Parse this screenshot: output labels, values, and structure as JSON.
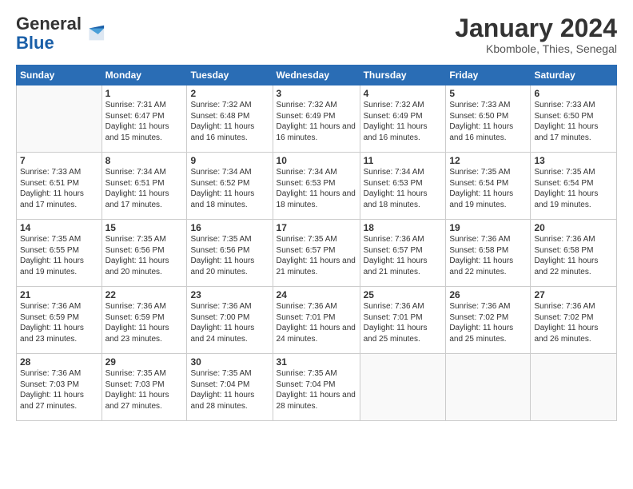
{
  "logo": {
    "general": "General",
    "blue": "Blue"
  },
  "title": "January 2024",
  "subtitle": "Kbombole, Thies, Senegal",
  "days_of_week": [
    "Sunday",
    "Monday",
    "Tuesday",
    "Wednesday",
    "Thursday",
    "Friday",
    "Saturday"
  ],
  "weeks": [
    [
      {
        "day": "",
        "sunrise": "",
        "sunset": "",
        "daylight": ""
      },
      {
        "day": "1",
        "sunrise": "Sunrise: 7:31 AM",
        "sunset": "Sunset: 6:47 PM",
        "daylight": "Daylight: 11 hours and 15 minutes."
      },
      {
        "day": "2",
        "sunrise": "Sunrise: 7:32 AM",
        "sunset": "Sunset: 6:48 PM",
        "daylight": "Daylight: 11 hours and 16 minutes."
      },
      {
        "day": "3",
        "sunrise": "Sunrise: 7:32 AM",
        "sunset": "Sunset: 6:49 PM",
        "daylight": "Daylight: 11 hours and 16 minutes."
      },
      {
        "day": "4",
        "sunrise": "Sunrise: 7:32 AM",
        "sunset": "Sunset: 6:49 PM",
        "daylight": "Daylight: 11 hours and 16 minutes."
      },
      {
        "day": "5",
        "sunrise": "Sunrise: 7:33 AM",
        "sunset": "Sunset: 6:50 PM",
        "daylight": "Daylight: 11 hours and 16 minutes."
      },
      {
        "day": "6",
        "sunrise": "Sunrise: 7:33 AM",
        "sunset": "Sunset: 6:50 PM",
        "daylight": "Daylight: 11 hours and 17 minutes."
      }
    ],
    [
      {
        "day": "7",
        "sunrise": "Sunrise: 7:33 AM",
        "sunset": "Sunset: 6:51 PM",
        "daylight": "Daylight: 11 hours and 17 minutes."
      },
      {
        "day": "8",
        "sunrise": "Sunrise: 7:34 AM",
        "sunset": "Sunset: 6:51 PM",
        "daylight": "Daylight: 11 hours and 17 minutes."
      },
      {
        "day": "9",
        "sunrise": "Sunrise: 7:34 AM",
        "sunset": "Sunset: 6:52 PM",
        "daylight": "Daylight: 11 hours and 18 minutes."
      },
      {
        "day": "10",
        "sunrise": "Sunrise: 7:34 AM",
        "sunset": "Sunset: 6:53 PM",
        "daylight": "Daylight: 11 hours and 18 minutes."
      },
      {
        "day": "11",
        "sunrise": "Sunrise: 7:34 AM",
        "sunset": "Sunset: 6:53 PM",
        "daylight": "Daylight: 11 hours and 18 minutes."
      },
      {
        "day": "12",
        "sunrise": "Sunrise: 7:35 AM",
        "sunset": "Sunset: 6:54 PM",
        "daylight": "Daylight: 11 hours and 19 minutes."
      },
      {
        "day": "13",
        "sunrise": "Sunrise: 7:35 AM",
        "sunset": "Sunset: 6:54 PM",
        "daylight": "Daylight: 11 hours and 19 minutes."
      }
    ],
    [
      {
        "day": "14",
        "sunrise": "Sunrise: 7:35 AM",
        "sunset": "Sunset: 6:55 PM",
        "daylight": "Daylight: 11 hours and 19 minutes."
      },
      {
        "day": "15",
        "sunrise": "Sunrise: 7:35 AM",
        "sunset": "Sunset: 6:56 PM",
        "daylight": "Daylight: 11 hours and 20 minutes."
      },
      {
        "day": "16",
        "sunrise": "Sunrise: 7:35 AM",
        "sunset": "Sunset: 6:56 PM",
        "daylight": "Daylight: 11 hours and 20 minutes."
      },
      {
        "day": "17",
        "sunrise": "Sunrise: 7:35 AM",
        "sunset": "Sunset: 6:57 PM",
        "daylight": "Daylight: 11 hours and 21 minutes."
      },
      {
        "day": "18",
        "sunrise": "Sunrise: 7:36 AM",
        "sunset": "Sunset: 6:57 PM",
        "daylight": "Daylight: 11 hours and 21 minutes."
      },
      {
        "day": "19",
        "sunrise": "Sunrise: 7:36 AM",
        "sunset": "Sunset: 6:58 PM",
        "daylight": "Daylight: 11 hours and 22 minutes."
      },
      {
        "day": "20",
        "sunrise": "Sunrise: 7:36 AM",
        "sunset": "Sunset: 6:58 PM",
        "daylight": "Daylight: 11 hours and 22 minutes."
      }
    ],
    [
      {
        "day": "21",
        "sunrise": "Sunrise: 7:36 AM",
        "sunset": "Sunset: 6:59 PM",
        "daylight": "Daylight: 11 hours and 23 minutes."
      },
      {
        "day": "22",
        "sunrise": "Sunrise: 7:36 AM",
        "sunset": "Sunset: 6:59 PM",
        "daylight": "Daylight: 11 hours and 23 minutes."
      },
      {
        "day": "23",
        "sunrise": "Sunrise: 7:36 AM",
        "sunset": "Sunset: 7:00 PM",
        "daylight": "Daylight: 11 hours and 24 minutes."
      },
      {
        "day": "24",
        "sunrise": "Sunrise: 7:36 AM",
        "sunset": "Sunset: 7:01 PM",
        "daylight": "Daylight: 11 hours and 24 minutes."
      },
      {
        "day": "25",
        "sunrise": "Sunrise: 7:36 AM",
        "sunset": "Sunset: 7:01 PM",
        "daylight": "Daylight: 11 hours and 25 minutes."
      },
      {
        "day": "26",
        "sunrise": "Sunrise: 7:36 AM",
        "sunset": "Sunset: 7:02 PM",
        "daylight": "Daylight: 11 hours and 25 minutes."
      },
      {
        "day": "27",
        "sunrise": "Sunrise: 7:36 AM",
        "sunset": "Sunset: 7:02 PM",
        "daylight": "Daylight: 11 hours and 26 minutes."
      }
    ],
    [
      {
        "day": "28",
        "sunrise": "Sunrise: 7:36 AM",
        "sunset": "Sunset: 7:03 PM",
        "daylight": "Daylight: 11 hours and 27 minutes."
      },
      {
        "day": "29",
        "sunrise": "Sunrise: 7:35 AM",
        "sunset": "Sunset: 7:03 PM",
        "daylight": "Daylight: 11 hours and 27 minutes."
      },
      {
        "day": "30",
        "sunrise": "Sunrise: 7:35 AM",
        "sunset": "Sunset: 7:04 PM",
        "daylight": "Daylight: 11 hours and 28 minutes."
      },
      {
        "day": "31",
        "sunrise": "Sunrise: 7:35 AM",
        "sunset": "Sunset: 7:04 PM",
        "daylight": "Daylight: 11 hours and 28 minutes."
      },
      {
        "day": "",
        "sunrise": "",
        "sunset": "",
        "daylight": ""
      },
      {
        "day": "",
        "sunrise": "",
        "sunset": "",
        "daylight": ""
      },
      {
        "day": "",
        "sunrise": "",
        "sunset": "",
        "daylight": ""
      }
    ]
  ]
}
